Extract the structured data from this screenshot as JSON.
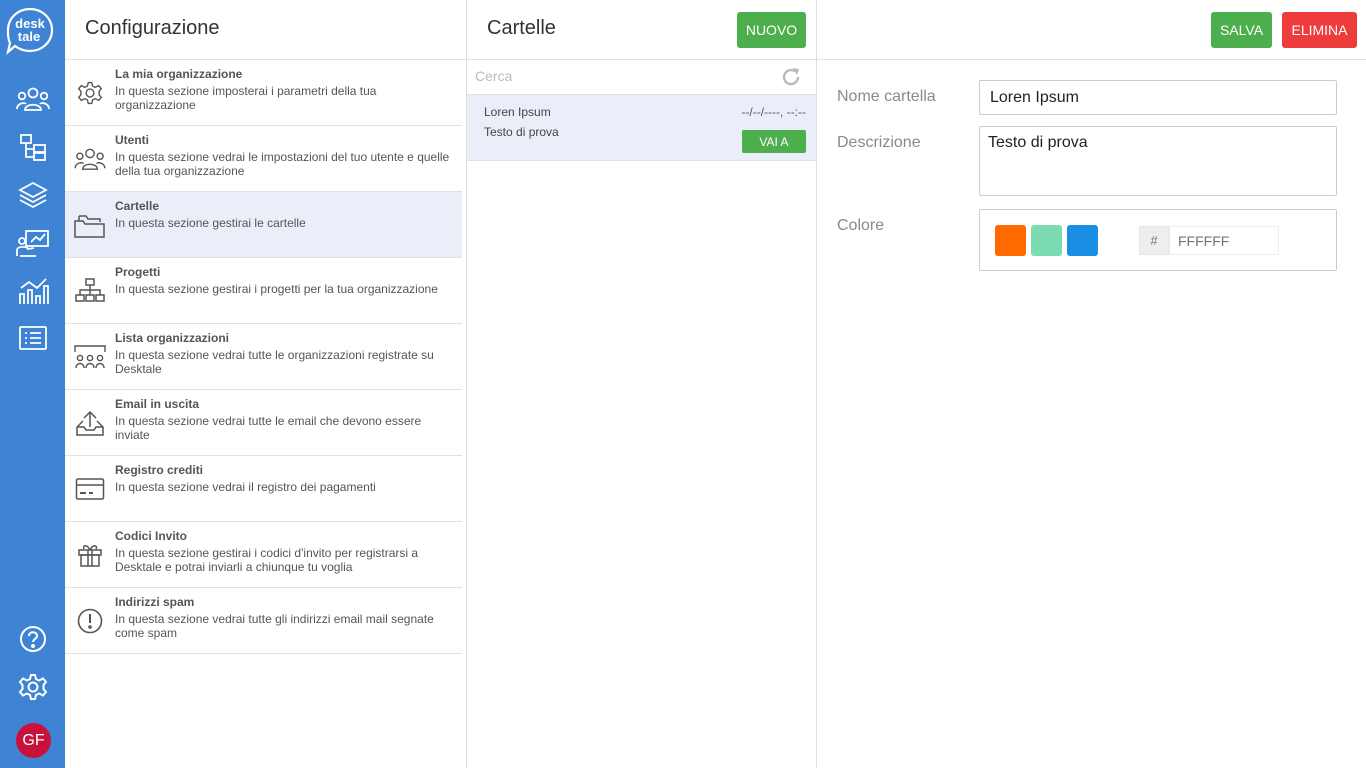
{
  "logo": {
    "line1": "desk",
    "line2": "tale"
  },
  "rail": {
    "icons": [
      "users-icon",
      "folders-icon",
      "layers-icon",
      "presentation-icon",
      "analytics-icon",
      "list-icon"
    ],
    "bottom_icons": [
      "help-icon",
      "settings-icon"
    ],
    "avatar_initials": "GF",
    "avatar_color": "#c8123c",
    "bg_color": "#3f83d4"
  },
  "config": {
    "title": "Configurazione",
    "items": [
      {
        "title": "La mia organizzazione",
        "desc": "In questa sezione imposterai i parametri della tua organizzazione",
        "icon": "gear-icon"
      },
      {
        "title": "Utenti",
        "desc": "In questa sezione vedrai le impostazioni del tuo utente e quelle della tua organizzazione",
        "icon": "users-icon"
      },
      {
        "title": "Cartelle",
        "desc": "In questa sezione gestirai le cartelle",
        "icon": "folder-icon"
      },
      {
        "title": "Progetti",
        "desc": "In questa sezione gestirai i progetti per la tua organizzazione",
        "icon": "hierarchy-icon"
      },
      {
        "title": "Lista organizzazioni",
        "desc": "In questa sezione vedrai tutte le organizzazioni registrate su Desktale",
        "icon": "organization-icon"
      },
      {
        "title": "Email in uscita",
        "desc": "In questa sezione vedrai tutte le email che devono essere inviate",
        "icon": "outbox-icon"
      },
      {
        "title": "Registro crediti",
        "desc": "In questa sezione vedrai il registro dei pagamenti",
        "icon": "credit-card-icon"
      },
      {
        "title": "Codici Invito",
        "desc": "In questa sezione gestirai i codici d'invito per registrarsi a Desktale e potrai inviarli a chiunque tu voglia",
        "icon": "gift-icon"
      },
      {
        "title": "Indirizzi spam",
        "desc": "In questa sezione vedrai tutte gli indirizzi email mail segnate come spam",
        "icon": "alert-icon"
      }
    ]
  },
  "folders": {
    "title": "Cartelle",
    "new_label": "NUOVO",
    "search_placeholder": "Cerca",
    "rows": [
      {
        "name": "Loren Ipsum",
        "desc": "Testo di prova",
        "date": "--/--/----, --:--",
        "goto_label": "VAI A"
      }
    ]
  },
  "detail": {
    "save_label": "SALVA",
    "delete_label": "ELIMINA",
    "name_label": "Nome cartella",
    "name_value": "Loren Ipsum",
    "desc_label": "Descrizione",
    "desc_value": "Testo di prova",
    "color_label": "Colore",
    "swatches": [
      "#ff6a00",
      "#7ddbb1",
      "#1a8fe3"
    ],
    "hex_prefix": "#",
    "hex_placeholder": "FFFFFF"
  }
}
